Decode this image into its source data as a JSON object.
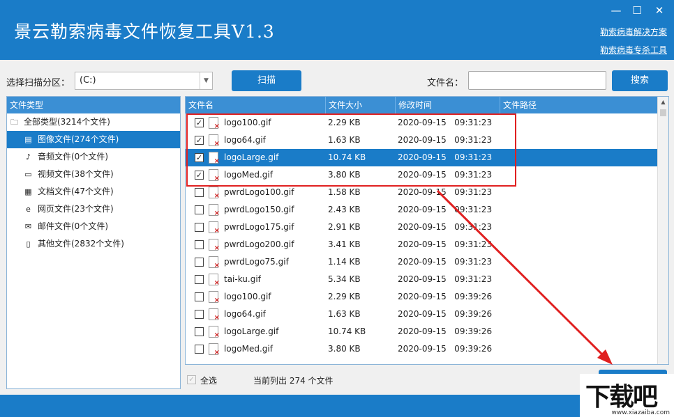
{
  "app": {
    "title": "景云勒索病毒文件恢复工具V1.3",
    "minimize": "—",
    "maximize": "☐",
    "close": "✕",
    "link1": "勒索病毒解决方案",
    "link2": "勒索病毒专杀工具"
  },
  "toolbar": {
    "partition_label": "选择扫描分区：",
    "partition_value": "(C:)",
    "scan_button": "扫描",
    "filename_label": "文件名：",
    "filename_value": "",
    "search_button": "搜索"
  },
  "left_panel": {
    "header": "文件类型",
    "items": [
      {
        "label": "全部类型(3214个文件)",
        "icon": "folder-icon"
      },
      {
        "label": "图像文件(274个文件)",
        "icon": "image-file-icon"
      },
      {
        "label": "音频文件(0个文件)",
        "icon": "audio-file-icon"
      },
      {
        "label": "视频文件(38个文件)",
        "icon": "video-file-icon"
      },
      {
        "label": "文档文件(47个文件)",
        "icon": "document-file-icon"
      },
      {
        "label": "网页文件(23个文件)",
        "icon": "ie-browser-icon"
      },
      {
        "label": "邮件文件(0个文件)",
        "icon": "mail-icon"
      },
      {
        "label": "其他文件(2832个文件)",
        "icon": "blank-file-icon"
      }
    ]
  },
  "file_table": {
    "columns": [
      "文件名",
      "文件大小",
      "修改时间",
      "文件路径"
    ],
    "rows": [
      {
        "name": "logo100.gif",
        "size": "2.29 KB",
        "date": "2020-09-15   09:31:23",
        "checked": true
      },
      {
        "name": "logo64.gif",
        "size": "1.63 KB",
        "date": "2020-09-15   09:31:23",
        "checked": true
      },
      {
        "name": "logoLarge.gif",
        "size": "10.74 KB",
        "date": "2020-09-15   09:31:23",
        "checked": true
      },
      {
        "name": "logoMed.gif",
        "size": "3.80 KB",
        "date": "2020-09-15   09:31:23",
        "checked": true
      },
      {
        "name": "pwrdLogo100.gif",
        "size": "1.58 KB",
        "date": "2020-09-15   09:31:23",
        "checked": false
      },
      {
        "name": "pwrdLogo150.gif",
        "size": "2.43 KB",
        "date": "2020-09-15   09:31:23",
        "checked": false
      },
      {
        "name": "pwrdLogo175.gif",
        "size": "2.91 KB",
        "date": "2020-09-15   09:31:23",
        "checked": false
      },
      {
        "name": "pwrdLogo200.gif",
        "size": "3.41 KB",
        "date": "2020-09-15   09:31:23",
        "checked": false
      },
      {
        "name": "pwrdLogo75.gif",
        "size": "1.14 KB",
        "date": "2020-09-15   09:31:23",
        "checked": false
      },
      {
        "name": "tai-ku.gif",
        "size": "5.34 KB",
        "date": "2020-09-15   09:31:23",
        "checked": false
      },
      {
        "name": "logo100.gif",
        "size": "2.29 KB",
        "date": "2020-09-15   09:39:26",
        "checked": false
      },
      {
        "name": "logo64.gif",
        "size": "1.63 KB",
        "date": "2020-09-15   09:39:26",
        "checked": false
      },
      {
        "name": "logoLarge.gif",
        "size": "10.74 KB",
        "date": "2020-09-15   09:39:26",
        "checked": false
      },
      {
        "name": "logoMed.gif",
        "size": "3.80 KB",
        "date": "2020-09-15   09:39:26",
        "checked": false
      }
    ],
    "selected_row": 2
  },
  "footer": {
    "select_all_label": "全选",
    "status_text": "当前列出 274 个文件"
  },
  "watermark": {
    "text": "下载吧",
    "sub": "www.xiazaiba.com"
  },
  "colors": {
    "accent": "#1a7cc8",
    "highlight": "#e02020"
  }
}
